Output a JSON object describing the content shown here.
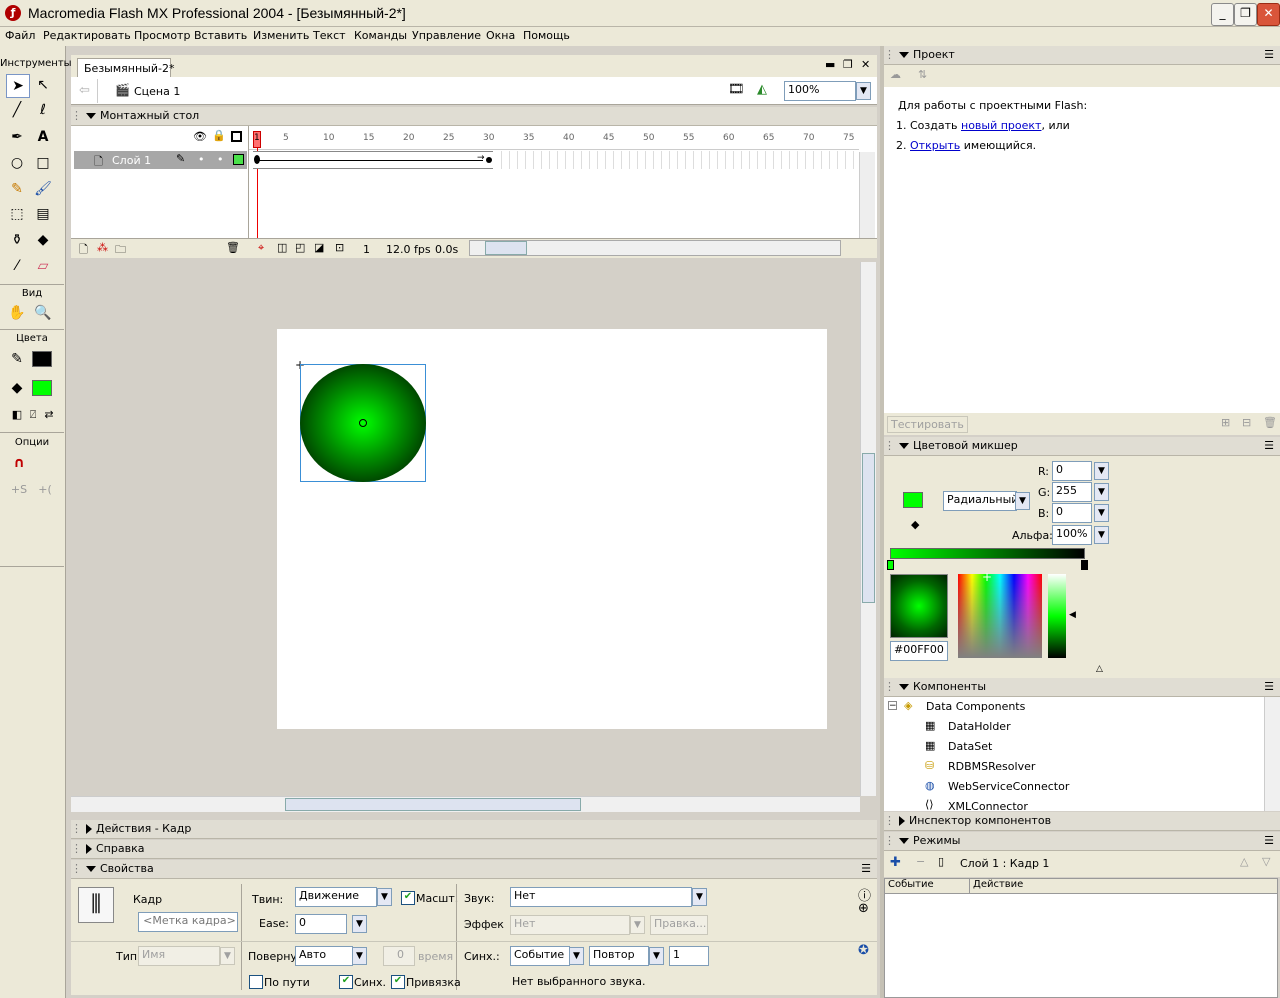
{
  "window": {
    "title": "Macromedia Flash MX Professional 2004 - [Безымянный-2*]",
    "app_icon": "flash-logo"
  },
  "menu": [
    "Файл",
    "Редактировать",
    "Просмотр",
    "Вставить",
    "Изменить",
    "Текст",
    "Команды",
    "Управление",
    "Окна",
    "Помощь"
  ],
  "tools": {
    "title": "Инструменты",
    "view_label": "Вид",
    "colors_label": "Цвета",
    "options_label": "Опции",
    "stroke_color": "#000000",
    "fill_color": "#00ff00"
  },
  "document": {
    "tab_label": "Безымянный-2*",
    "scene_label": "Сцена 1",
    "zoom": "100%"
  },
  "timeline": {
    "title": "Монтажный стол",
    "frame_ticks": [
      "1",
      "5",
      "10",
      "15",
      "20",
      "25",
      "30",
      "35",
      "40",
      "45",
      "50",
      "55",
      "60",
      "65",
      "70",
      "75"
    ],
    "layer_name": "Слой 1",
    "current_frame": "1",
    "fps": "12.0 fps",
    "elapsed": "0.0s"
  },
  "project_panel": {
    "title": "Проект",
    "intro": "Для работы с проектными Flash:",
    "item1_prefix": "1. Создать ",
    "item1_link": "новый проект",
    "item1_suffix": ", или",
    "item2_prefix": "2. ",
    "item2_link": "Открыть",
    "item2_suffix": " имеющийся.",
    "test_button": "Тестировать"
  },
  "color_mixer": {
    "title": "Цветовой микшер",
    "fill_type": "Радиальный",
    "r_label": "R:",
    "r": "0",
    "g_label": "G:",
    "g": "255",
    "b_label": "B:",
    "b": "0",
    "alpha_label": "Альфа:",
    "alpha": "100%",
    "hex": "#00FF00",
    "accent": "#00ff00"
  },
  "components": {
    "title": "Компоненты",
    "group": "Data Components",
    "items": [
      "DataHolder",
      "DataSet",
      "RDBMSResolver",
      "WebServiceConnector",
      "XMLConnector"
    ]
  },
  "component_inspector": {
    "title": "Инспектор компонентов"
  },
  "behaviors": {
    "title": "Режимы",
    "context": "Слой 1 : Кадр 1",
    "col_event": "Событие",
    "col_action": "Действие"
  },
  "bottom_panels": {
    "actions": "Действия - Кадр",
    "help": "Справка",
    "properties": "Свойства"
  },
  "properties": {
    "frame_label": "Кадр",
    "frame_name_placeholder": "<Метка кадра>",
    "tween_label": "Твин:",
    "tween_value": "Движение",
    "scale_label": "Масшт.",
    "ease_label": "Ease:",
    "ease_value": "0",
    "sound_label": "Звук:",
    "sound_value": "Нет",
    "effect_label": "Эффек",
    "effect_value": "Нет",
    "edit_button": "Правка...",
    "type_label": "Тип",
    "type_value": "Имя",
    "rotate_label": "Поверну",
    "rotate_value": "Авто",
    "times_value": "0",
    "times_label": "время",
    "sync_label": "Синх.:",
    "sync_value": "Событие",
    "repeat_value": "Повтор",
    "repeat_count": "1",
    "orient_label": "По пути",
    "sync_check_label": "Синх.",
    "snap_label": "Привязка",
    "no_sound": "Нет выбранного звука."
  }
}
